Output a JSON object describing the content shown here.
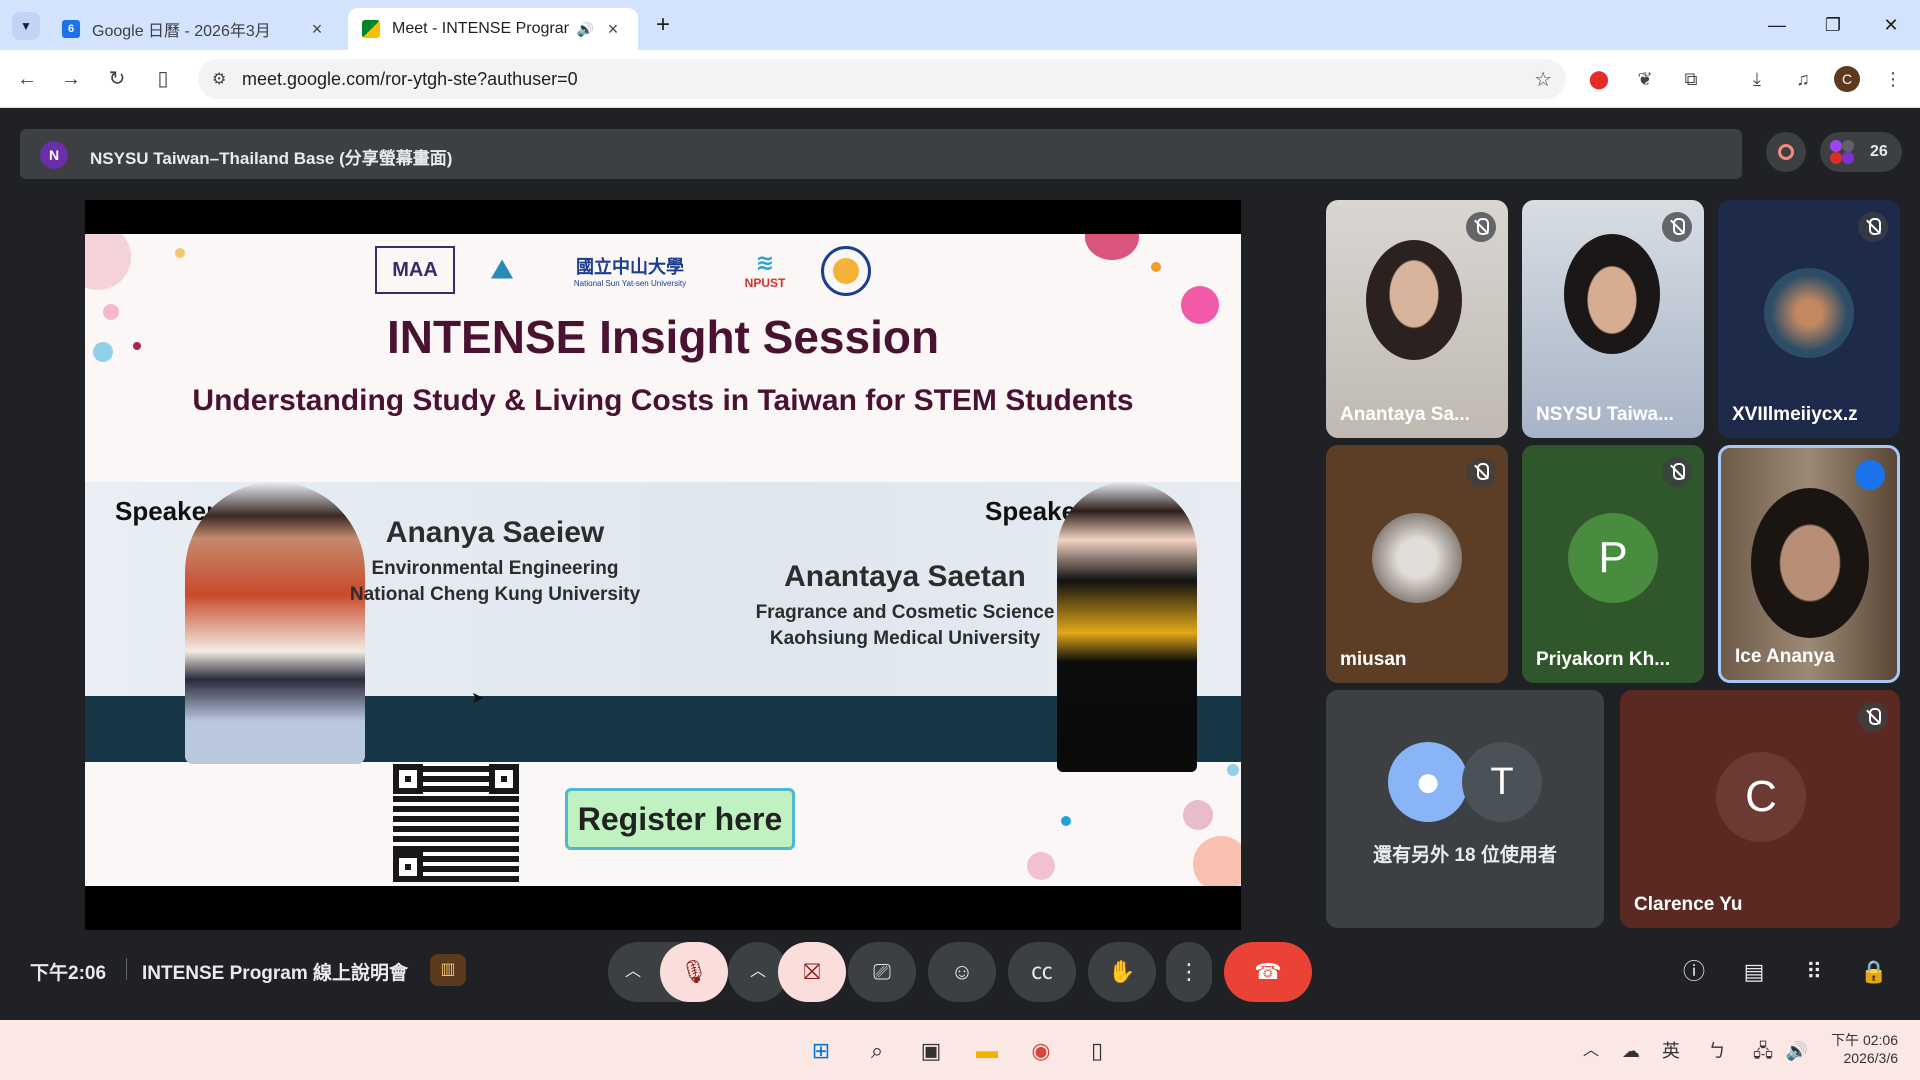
{
  "browser": {
    "tabs": [
      {
        "title": "Google 日曆 - 2026年3月",
        "favicon": "6",
        "active": false
      },
      {
        "title": "Meet - INTENSE Program",
        "favicon": "meet",
        "active": true
      }
    ],
    "new_tab": "+",
    "url": "meet.google.com/ror-ytgh-ste?authuser=0",
    "profile_initial": "C"
  },
  "meet": {
    "presenter_initial": "N",
    "presenting_title": "NSYSU Taiwan–Thailand Base (分享螢幕畫面)",
    "participant_count": "26",
    "clock": "下午2:06",
    "meeting_name": "INTENSE Program 線上說明會",
    "others_label": "還有另外 18 位使用者",
    "others_avatar": "T",
    "tiles": [
      {
        "name": "Anantaya Sa...",
        "muted": true
      },
      {
        "name": "NSYSU Taiwa...",
        "muted": true
      },
      {
        "name": "XVIIlmeiiycx.z",
        "muted": true
      },
      {
        "name": "miusan",
        "muted": true
      },
      {
        "name": "Priyakorn Kh...",
        "initial": "P",
        "muted": true
      },
      {
        "name": "Ice Ananya",
        "muted": false
      },
      {
        "name": "Clarence Yu",
        "initial": "C",
        "muted": true
      }
    ],
    "accent_colors": {
      "end_call": "#ea4335",
      "muted_ctl": "#f9dedc",
      "active_speaker": "#1a73e8"
    }
  },
  "slide": {
    "logos": [
      "MAA",
      "國立中山大學",
      "National Sun Yat-sen University",
      "NPUST"
    ],
    "title": "INTENSE Insight Session",
    "subtitle": "Understanding Study & Living Costs in Taiwan for STEM Students",
    "speaker_label": "Speaker:",
    "speaker1": {
      "name": "Ananya Saeiew",
      "line1": "Environmental Engineering",
      "line2": "National Cheng Kung University"
    },
    "speaker2": {
      "name": "Anantaya Saetan",
      "line1": "Fragrance and Cosmetic Science",
      "line2": "Kaohsiung Medical University"
    },
    "register": "Register here"
  },
  "taskbar": {
    "ime": "英",
    "ime2": "ㄅ",
    "time": "下午 02:06",
    "date": "2026/3/6"
  }
}
